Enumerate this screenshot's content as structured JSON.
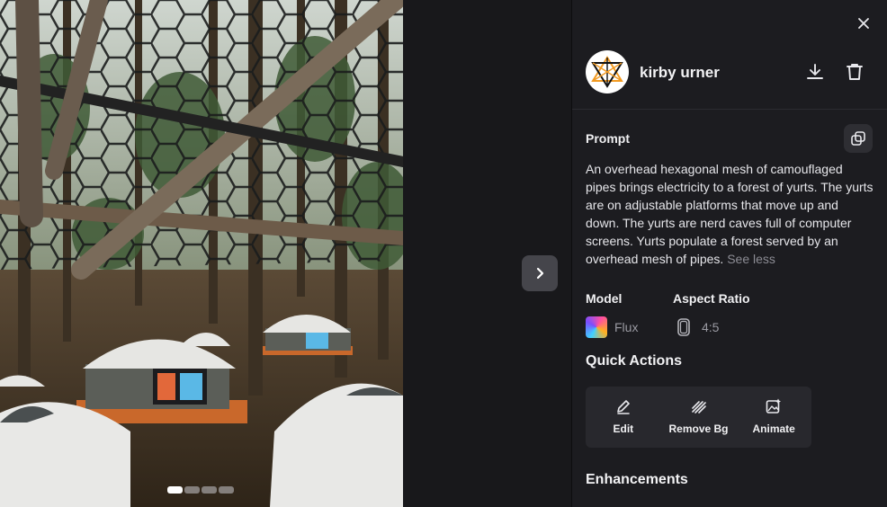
{
  "image": {
    "description_icon": "generated-image",
    "carousel_count": 4,
    "carousel_active": 0
  },
  "user": {
    "name": "kirby urner"
  },
  "prompt": {
    "label": "Prompt",
    "text": "An overhead hexagonal mesh of camouflaged pipes brings electricity to a forest of yurts. The yurts are on adjustable platforms that move up and down. The yurts are nerd caves full of computer screens. Yurts populate a forest served by an overhead mesh of pipes.",
    "toggle": "See less"
  },
  "model": {
    "label": "Model",
    "value": "Flux"
  },
  "aspect_ratio": {
    "label": "Aspect Ratio",
    "value": "4:5"
  },
  "quick_actions": {
    "title": "Quick Actions",
    "items": [
      {
        "label": "Edit",
        "icon": "pencil-icon"
      },
      {
        "label": "Remove Bg",
        "icon": "remove-bg-icon"
      },
      {
        "label": "Animate",
        "icon": "animate-icon"
      }
    ]
  },
  "enhancements": {
    "title": "Enhancements"
  },
  "colors": {
    "panel_bg": "#1c1c20",
    "accent": "#f29a21"
  }
}
